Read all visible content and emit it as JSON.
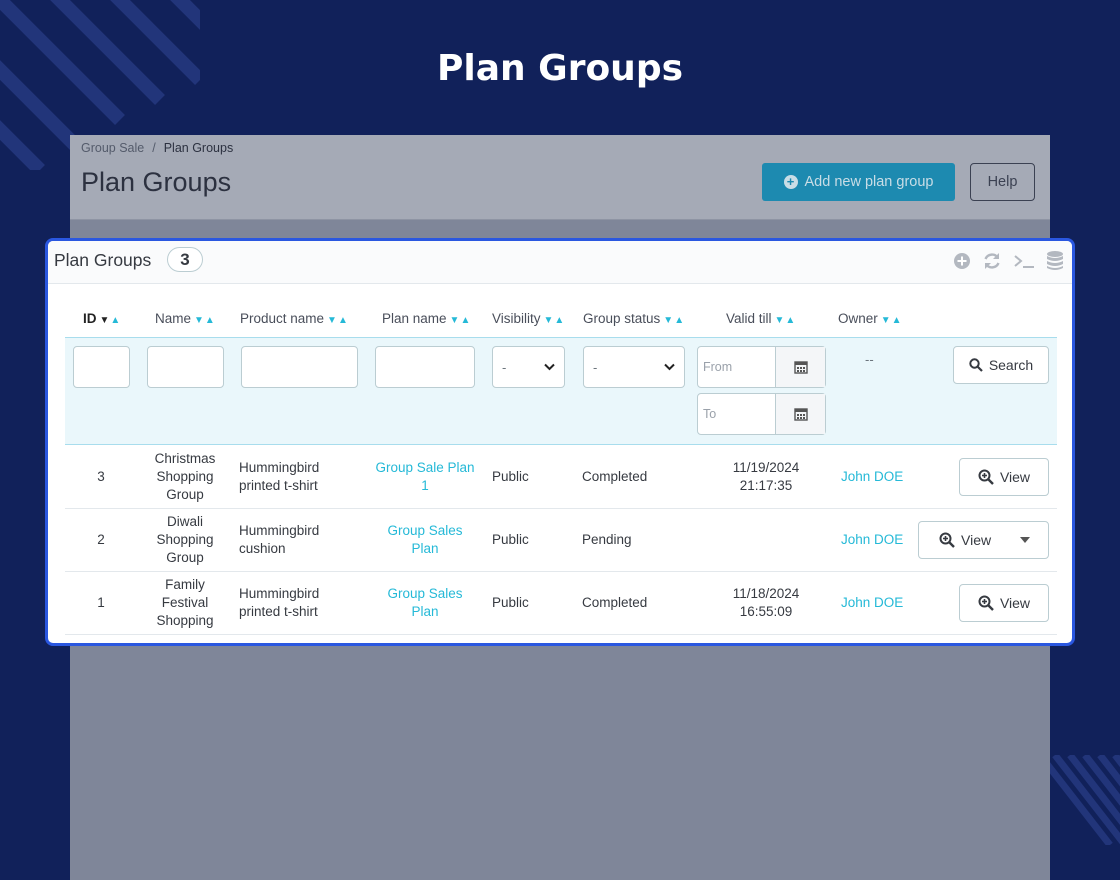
{
  "hero": {
    "title": "Plan Groups"
  },
  "admin": {
    "breadcrumb": [
      "Group Sale",
      "Plan Groups"
    ],
    "title": "Plan Groups",
    "add_button": "Add new plan group",
    "help_button": "Help"
  },
  "panel": {
    "title": "Plan Groups",
    "count": "3",
    "tool_icons": [
      "add-icon",
      "refresh-icon",
      "sql-query-icon",
      "database-export-icon"
    ]
  },
  "columns": [
    "ID",
    "Name",
    "Product name",
    "Plan name",
    "Visibility",
    "Group status",
    "Valid till",
    "Owner"
  ],
  "filters": {
    "visibility": "-",
    "group_status": "-",
    "date_from_placeholder": "From",
    "date_to_placeholder": "To",
    "owner": "--",
    "search_button": "Search"
  },
  "rows": [
    {
      "id": "3",
      "name": "Christmas Shopping Group",
      "product": "Hummingbird printed t-shirt",
      "plan": "Group Sale Plan 1",
      "visibility": "Public",
      "status": "Completed",
      "valid_date": "11/19/2024",
      "valid_time": "21:17:35",
      "owner": "John DOE",
      "action": "View"
    },
    {
      "id": "2",
      "name": "Diwali Shopping Group",
      "product": "Hummingbird cushion",
      "plan": "Group Sales Plan",
      "visibility": "Public",
      "status": "Pending",
      "valid_date": "",
      "valid_time": "",
      "owner": "John DOE",
      "action": "View"
    },
    {
      "id": "1",
      "name": "Family Festival Shopping",
      "product": "Hummingbird printed t-shirt",
      "plan": "Group Sales Plan",
      "visibility": "Public",
      "status": "Completed",
      "valid_date": "11/18/2024",
      "valid_time": "16:55:09",
      "owner": "John DOE",
      "action": "View"
    }
  ],
  "colors": {
    "background": "#11215a",
    "accent": "#25b9d7",
    "highlight_border": "#2a57e0"
  }
}
